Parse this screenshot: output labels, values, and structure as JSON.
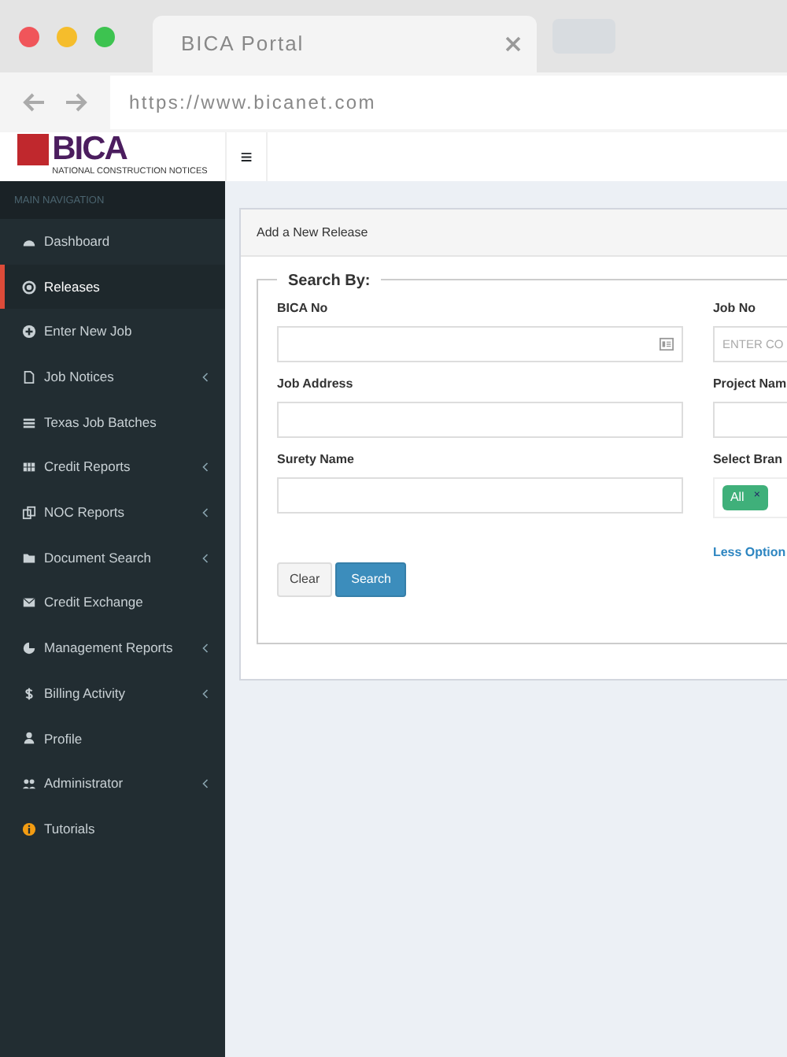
{
  "browser": {
    "tab_title": "BICA Portal",
    "url": "https://www.bicanet.com"
  },
  "header": {
    "logo": "BICA",
    "logo_tagline": "NATIONAL CONSTRUCTION NOTICES",
    "menu_glyph": "≡"
  },
  "sidebar": {
    "heading": "MAIN NAVIGATION",
    "items": [
      {
        "label": "Dashboard",
        "selected": false,
        "has_submenu": false
      },
      {
        "label": "Releases",
        "selected": true,
        "has_submenu": false
      },
      {
        "label": "Enter New Job",
        "selected": false,
        "has_submenu": false
      },
      {
        "label": "Job Notices",
        "selected": false,
        "has_submenu": true
      },
      {
        "label": "Texas Job Batches",
        "selected": false,
        "has_submenu": false
      },
      {
        "label": "Credit Reports",
        "selected": false,
        "has_submenu": true
      },
      {
        "label": "NOC Reports",
        "selected": false,
        "has_submenu": true
      },
      {
        "label": "Document Search",
        "selected": false,
        "has_submenu": true
      },
      {
        "label": "Credit Exchange",
        "selected": false,
        "has_submenu": false
      },
      {
        "label": "Management Reports",
        "selected": false,
        "has_submenu": true
      },
      {
        "label": "Billing Activity",
        "selected": false,
        "has_submenu": true
      },
      {
        "label": "Profile",
        "selected": false,
        "has_submenu": false
      },
      {
        "label": "Administrator",
        "selected": false,
        "has_submenu": true
      },
      {
        "label": "Tutorials",
        "selected": false,
        "has_submenu": false
      }
    ]
  },
  "panel": {
    "title": "Add a New Release",
    "legend": "Search By:",
    "left_fields": [
      {
        "label": "BICA No",
        "has_icon": true
      },
      {
        "label": "Job Address",
        "has_icon": false
      },
      {
        "label": "Surety Name",
        "has_icon": false
      }
    ],
    "right_fields": [
      {
        "kind": "text",
        "label": "Job No",
        "placeholder": "ENTER CO"
      },
      {
        "kind": "text",
        "label": "Project Nam"
      },
      {
        "kind": "tags",
        "label": "Select Bran",
        "tags": [
          {
            "label": "All",
            "remove": "×"
          }
        ]
      }
    ],
    "less_options": "Less Option",
    "buttons": [
      {
        "label": "Clear",
        "kind": "default"
      },
      {
        "label": "Search",
        "kind": "primary"
      }
    ]
  }
}
